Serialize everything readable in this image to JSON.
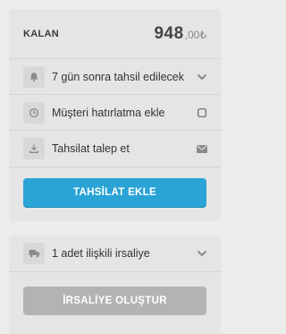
{
  "balance": {
    "label": "KALAN",
    "main": "948",
    "cents": ",00",
    "currency": "₺"
  },
  "rows": [
    {
      "label": "7 gün sonra tahsil edilecek",
      "icon": "bell-icon",
      "action": "chevron-down-icon"
    },
    {
      "label": "Müşteri hatırlatma ekle",
      "icon": "clock-icon",
      "action": "checkbox"
    },
    {
      "label": "Tahsilat talep et",
      "icon": "download-icon",
      "action": "envelope-icon"
    }
  ],
  "collect_button": {
    "label": "TAHSİLAT EKLE",
    "color": "#2aa4d6"
  },
  "waybill": {
    "row_label": "1 adet ilişkili irsaliye",
    "icon": "truck-icon",
    "action": "chevron-down-icon",
    "button_label": "İRSALİYE OLUŞTUR",
    "button_color": "#b3b3b3"
  }
}
